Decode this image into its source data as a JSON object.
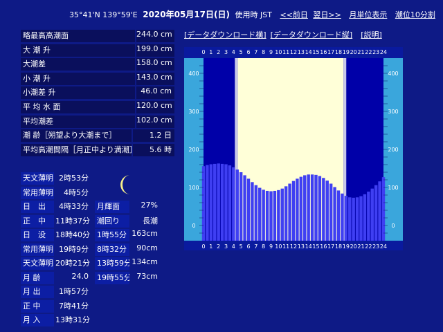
{
  "header": {
    "coords": "35°41'N 139°59'E",
    "date": "2020年05月17日(日)",
    "timezone": "使用時 JST",
    "prev_day": "<<前日",
    "next_day": "翌日>>",
    "monthly": "月単位表示",
    "interval": "潮位10分割"
  },
  "tide_summary": [
    {
      "label": "略最高高潮面",
      "value": "244.0 cm"
    },
    {
      "label": "大 潮 升",
      "value": "199.0 cm"
    },
    {
      "label": "大潮差",
      "value": "158.0 cm"
    },
    {
      "label": "小 潮 升",
      "value": "143.0 cm"
    },
    {
      "label": "小潮差 升",
      "value": "46.0 cm"
    },
    {
      "label": "平 均 水 面",
      "value": "120.0 cm"
    },
    {
      "label": "平均潮差",
      "value": "102.0 cm"
    },
    {
      "label": "潮 齢［朔望より大潮まで］",
      "value": "1.2 日"
    },
    {
      "label": "平均高潮間隔［月正中より満潮］",
      "value": "5.6 時"
    }
  ],
  "sun_moon": [
    {
      "label": "天文薄明",
      "value": "2時53分"
    },
    {
      "label": "常用薄明",
      "value": "4時5分"
    },
    {
      "label": "日　出",
      "value": "4時33分"
    },
    {
      "label": "正　中",
      "value": "11時37分"
    },
    {
      "label": "日　没",
      "value": "18時40分"
    },
    {
      "label": "常用薄明",
      "value": "19時9分"
    },
    {
      "label": "天文薄明",
      "value": "20時21分"
    },
    {
      "label": "月 齢",
      "value": "24.0"
    },
    {
      "label": "月 出",
      "value": "1時57分"
    },
    {
      "label": "正 中",
      "value": "7時41分"
    },
    {
      "label": "月 入",
      "value": "13時31分"
    }
  ],
  "moon_info": [
    {
      "label": "月輝面",
      "value": "27%"
    },
    {
      "label": "潮回り",
      "value": "長潮"
    }
  ],
  "tide_events": [
    {
      "time": "1時55分",
      "value": "163cm"
    },
    {
      "time": "8時32分",
      "value": "90cm"
    },
    {
      "time": "13時59分",
      "value": "134cm"
    },
    {
      "time": "19時55分",
      "value": "73cm"
    }
  ],
  "links": {
    "download_h": "[データダウンロード横]",
    "download_v": "[データダウンロード縦]",
    "help": "[説明]"
  },
  "colors": {
    "background": "#0e1a86",
    "bar": "#3f3ff2",
    "daylight": "#ffffd8",
    "night": "#0000a8",
    "scale": "#3aa6dc"
  },
  "chart_data": {
    "type": "bar",
    "x_ticks": [
      "0",
      "1",
      "2",
      "3",
      "4",
      "5",
      "6",
      "7",
      "8",
      "9",
      "10",
      "11",
      "12",
      "13",
      "14",
      "15",
      "16",
      "17",
      "18",
      "19",
      "20",
      "21",
      "22",
      "23",
      "24"
    ],
    "y_ticks": [
      "400",
      "300",
      "200",
      "100",
      "0"
    ],
    "ylim": [
      -40,
      440
    ],
    "xlim": [
      0,
      24
    ],
    "daylight": [
      4.55,
      18.67
    ],
    "x": [
      0,
      0.5,
      1,
      1.5,
      2,
      2.5,
      3,
      3.5,
      4,
      4.5,
      5,
      5.5,
      6,
      6.5,
      7,
      7.5,
      8,
      8.5,
      9,
      9.5,
      10,
      10.5,
      11,
      11.5,
      12,
      12.5,
      13,
      13.5,
      14,
      14.5,
      15,
      15.5,
      16,
      16.5,
      17,
      17.5,
      18,
      18.5,
      19,
      19.5,
      20,
      20.5,
      21,
      21.5,
      22,
      22.5,
      23,
      23.5,
      24
    ],
    "values": [
      156,
      159,
      161,
      162,
      163,
      162,
      161,
      158,
      153,
      147,
      140,
      132,
      123,
      114,
      106,
      99,
      94,
      91,
      90,
      91,
      93,
      97,
      103,
      110,
      117,
      123,
      128,
      132,
      134,
      134,
      133,
      130,
      125,
      118,
      110,
      101,
      92,
      84,
      78,
      74,
      73,
      74,
      77,
      82,
      89,
      97,
      106,
      116,
      127
    ]
  }
}
